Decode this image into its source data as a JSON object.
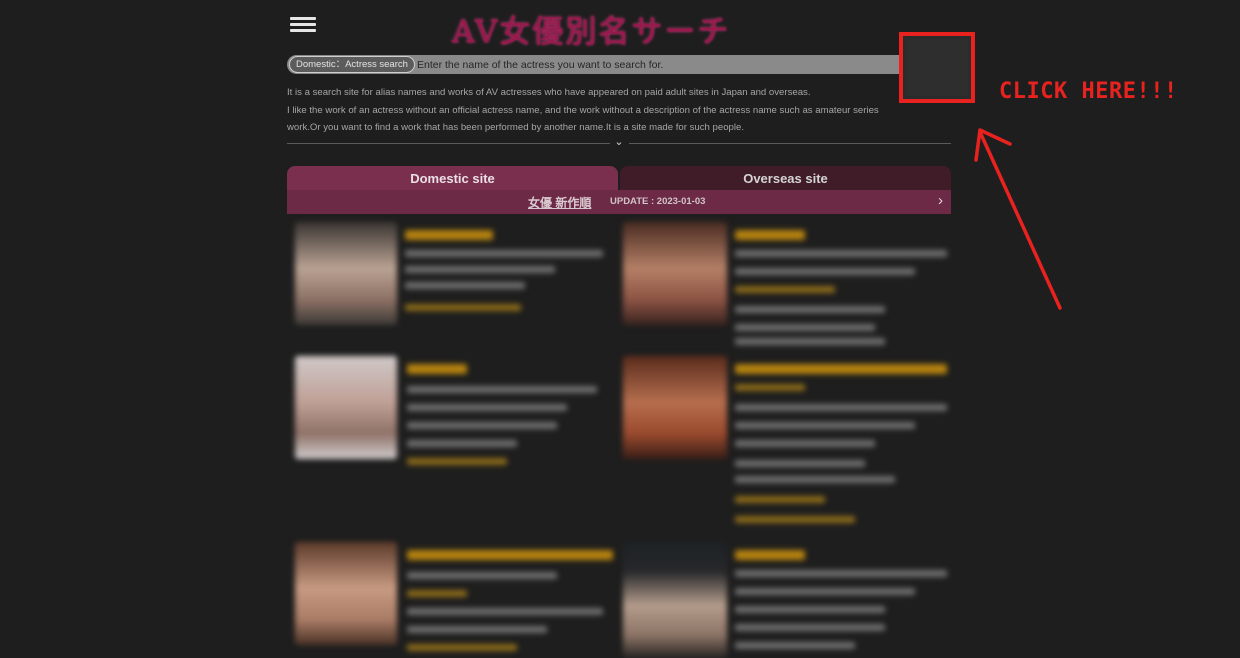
{
  "header": {
    "menu_icon": "hamburger-menu-icon",
    "logo_text": "AV女優別名サーチ"
  },
  "search": {
    "mode_label": "Domestic：Actress search",
    "placeholder": "Enter the name of the actress you want to search for.",
    "more_icon": "ellipsis-icon",
    "more_glyph": "•••"
  },
  "description": {
    "line1": "It is a search site for alias names and works of AV actresses who have appeared on paid adult sites in Japan and overseas.",
    "line2": "I like the work of an actress without an official actress name, and the work without a description of the actress name such as amateur series",
    "line3": "work.Or you want to find a work that has been performed by another name.It is a site made for such people.",
    "expand_icon": "chevron-down-icon",
    "expand_glyph": "⌄"
  },
  "tabs": [
    {
      "label": "Domestic site",
      "active": true
    },
    {
      "label": "Overseas site",
      "active": false
    }
  ],
  "subbar": {
    "link_text": "女優 新作順",
    "update_text": "UPDATE : 2023-01-03",
    "arrow_glyph": "›"
  },
  "annotation": {
    "callout_text": "CLICK HERE!!!",
    "color": "#e8231f"
  },
  "colors": {
    "background": "#1e1e1e",
    "tab_active": "#7a2f4f",
    "tab_inactive": "#401c28",
    "accent_gold": "#b5830f"
  }
}
